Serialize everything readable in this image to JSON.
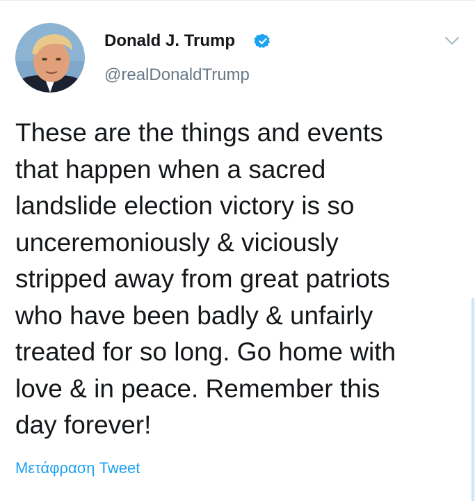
{
  "tweet": {
    "author": {
      "display_name": "Donald J. Trump",
      "handle": "@realDonaldTrump",
      "verified": true,
      "avatar_icon": "profile-photo"
    },
    "text": "These are the things and events\nthat happen when a sacred\nlandslide election victory is so\nunceremoniously & viciously\nstripped away from great patriots\nwho have been badly & unfairly\ntreated for so long. Go home with\nlove & in peace. Remember this\nday forever!",
    "translate_label": "Μετάφραση Tweet",
    "menu_icon": "chevron-down-icon"
  },
  "colors": {
    "text": "#14171a",
    "secondary": "#657786",
    "accent": "#1da1f2",
    "verified_badge": "#1da1f2"
  }
}
